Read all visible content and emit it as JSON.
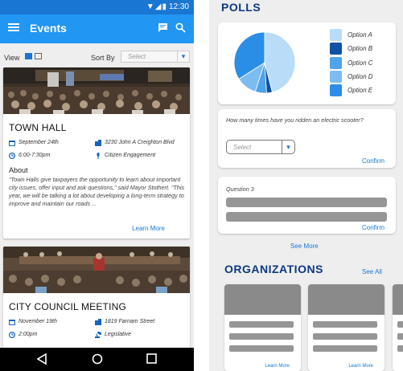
{
  "status_bar": {
    "time": "12:30"
  },
  "app_bar": {
    "title": "Events"
  },
  "filters": {
    "view_label": "View",
    "sort_label": "Sort By",
    "sort_placeholder": "Select"
  },
  "events": [
    {
      "title": "TOWN HALL",
      "date": "September 24th",
      "address": "3230 John A Creighton Blvd",
      "time": "6:00-7:30pm",
      "category": "Citizen Engagement",
      "about_heading": "About",
      "about_text": "\"Town Halls give taxpayers the opportunity to learn about important city issues, offer input and ask questions,\" said Mayor Stothert.  \"This year, we will be talking a lot about developing a long-term strategy to improve and maintain our roads ...",
      "learn_more": "Learn More"
    },
    {
      "title": "CITY COUNCIL MEETING",
      "date": "November 19th",
      "address": "1819 Farnam Street",
      "time": "2:00pm",
      "category": "Legislative"
    }
  ],
  "polls": {
    "heading": "POLLS",
    "legend": [
      "Option A",
      "Option B",
      "Option C",
      "Option D",
      "Option E"
    ],
    "question_2": "How many times have you ridden an electric scooter?",
    "select_placeholder": "Select",
    "question_3": "Question 3",
    "confirm_label": "Confirm",
    "see_more": "See More"
  },
  "chart_data": {
    "type": "pie",
    "categories": [
      "Option A",
      "Option B",
      "Option C",
      "Option D",
      "Option E"
    ],
    "values": [
      46,
      3,
      6,
      11,
      34
    ],
    "colors": [
      "#b9dcf8",
      "#0d52a4",
      "#4fa3ea",
      "#7dbcf1",
      "#2b8ee6"
    ]
  },
  "organizations": {
    "heading": "ORGANIZATIONS",
    "see_all": "See All",
    "cards": [
      {
        "learn_more": "Learn More"
      },
      {
        "learn_more": "Learn More"
      },
      {
        "learn_more": ""
      }
    ]
  }
}
